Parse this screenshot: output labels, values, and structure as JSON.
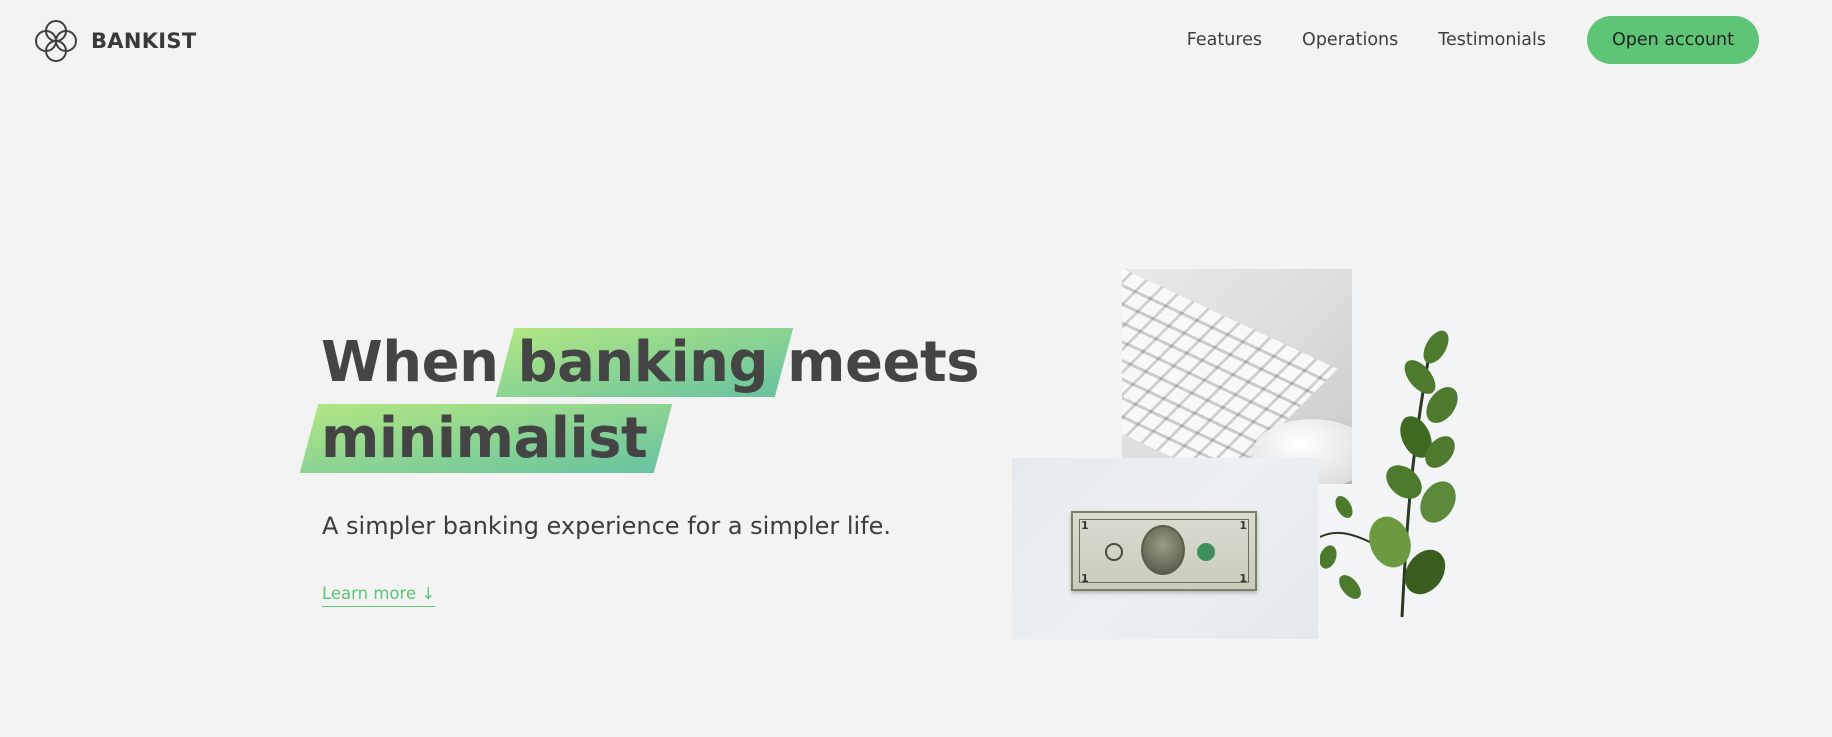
{
  "brand": {
    "name": "BANKIST",
    "logo_icon": "four-circle-logo-icon"
  },
  "nav": {
    "links": [
      {
        "label": "Features"
      },
      {
        "label": "Operations"
      },
      {
        "label": "Testimonials"
      }
    ],
    "cta_label": "Open account"
  },
  "hero": {
    "title_word1": "When",
    "title_highlight1": "banking",
    "title_word2": "meets",
    "title_highlight2": "minimalist",
    "subtitle": "A simpler banking experience for a simpler life.",
    "learn_more": "Learn more ↓"
  },
  "images": {
    "keyboard": "keyboard-and-mouse-image",
    "plant": "plant-image",
    "dollar": "dollar-bill-image"
  },
  "colors": {
    "accent": "#5ec576",
    "background": "#f3f3f3",
    "gradient_start": "#9be15d",
    "gradient_end": "#39b385"
  }
}
